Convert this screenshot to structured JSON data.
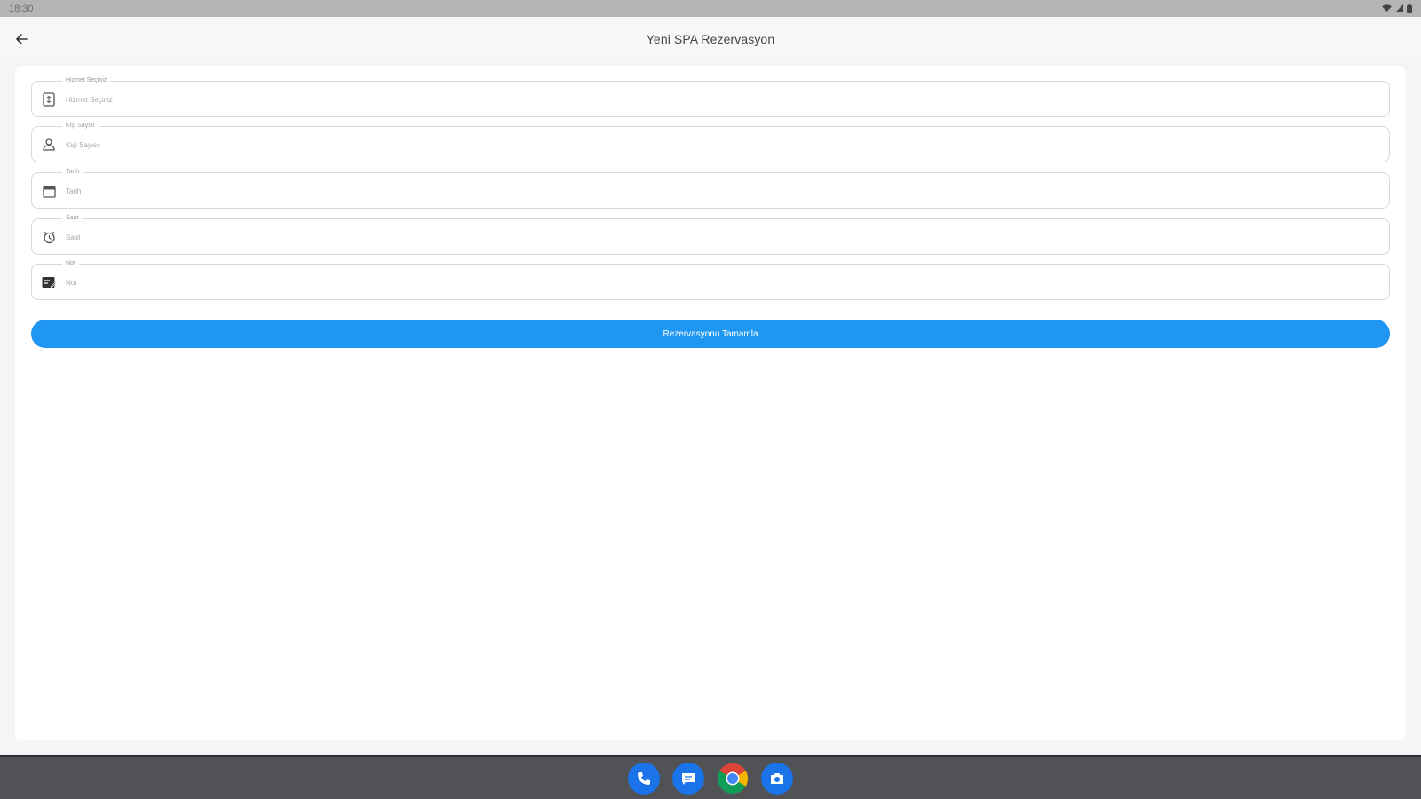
{
  "status_bar": {
    "time": "18:30"
  },
  "app_bar": {
    "title": "Yeni SPA Rezervasyon"
  },
  "form": {
    "fields": [
      {
        "label": "Hizmet Seçiniz",
        "placeholder": "Hizmet Seçiniz",
        "icon": "receipt-icon"
      },
      {
        "label": "Kişi Sayısı",
        "placeholder": "Kişi Sayısı",
        "icon": "person-icon"
      },
      {
        "label": "Tarih",
        "placeholder": "Tarih",
        "icon": "calendar-icon"
      },
      {
        "label": "Saat",
        "placeholder": "Saat",
        "icon": "clock-icon"
      },
      {
        "label": "Not",
        "placeholder": "Not",
        "icon": "note-icon"
      }
    ],
    "submit_label": "Rezervasyonu Tamamla"
  },
  "dock": {
    "apps": [
      {
        "icon": "phone-icon"
      },
      {
        "icon": "messages-icon"
      },
      {
        "icon": "chrome-icon"
      },
      {
        "icon": "camera-icon"
      }
    ]
  },
  "colors": {
    "primary": "#1f96f2",
    "status_bar": "#b5b5b5",
    "nav_bar": "#505255"
  }
}
